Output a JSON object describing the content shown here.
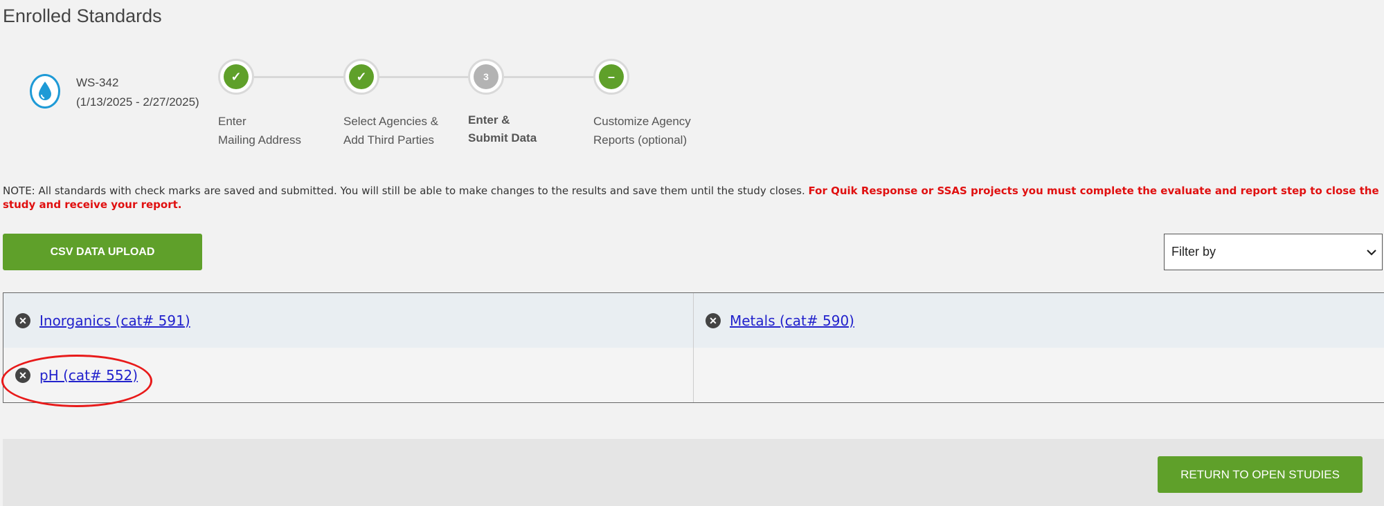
{
  "page": {
    "title": "Enrolled Standards"
  },
  "study": {
    "icon": "water-drop-icon",
    "id": "WS-342",
    "dates": "(1/13/2025 - 2/27/2025)"
  },
  "steps": [
    {
      "marker": "✓",
      "state": "done",
      "line1": "Enter",
      "line2": "Mailing Address"
    },
    {
      "marker": "✓",
      "state": "done",
      "line1": "Select Agencies &",
      "line2": "Add Third Parties"
    },
    {
      "marker": "3",
      "state": "current",
      "line1": "Enter &",
      "line2": "Submit Data"
    },
    {
      "marker": "–",
      "state": "pending",
      "line1": "Customize Agency",
      "line2": "Reports (optional)"
    }
  ],
  "note": {
    "text": "NOTE: All standards with check marks are saved and submitted. You will still be able to make changes to the results and save them until the study closes. ",
    "warning": "For Quik Response or SSAS projects you must complete the evaluate and report step to close the study and receive your report."
  },
  "toolbar": {
    "csv_upload_label": "CSV DATA UPLOAD",
    "filter_selected": "Filter by"
  },
  "standards": [
    {
      "label": "Inorganics (cat# 591)"
    },
    {
      "label": "Metals (cat# 590)"
    },
    {
      "label": "pH (cat# 552)"
    }
  ],
  "footer": {
    "return_label": "RETURN TO OPEN STUDIES"
  },
  "colors": {
    "accent": "#5fa02a",
    "warning": "#e01010",
    "link": "#2222cc",
    "study_icon": "#1e9ad6"
  }
}
